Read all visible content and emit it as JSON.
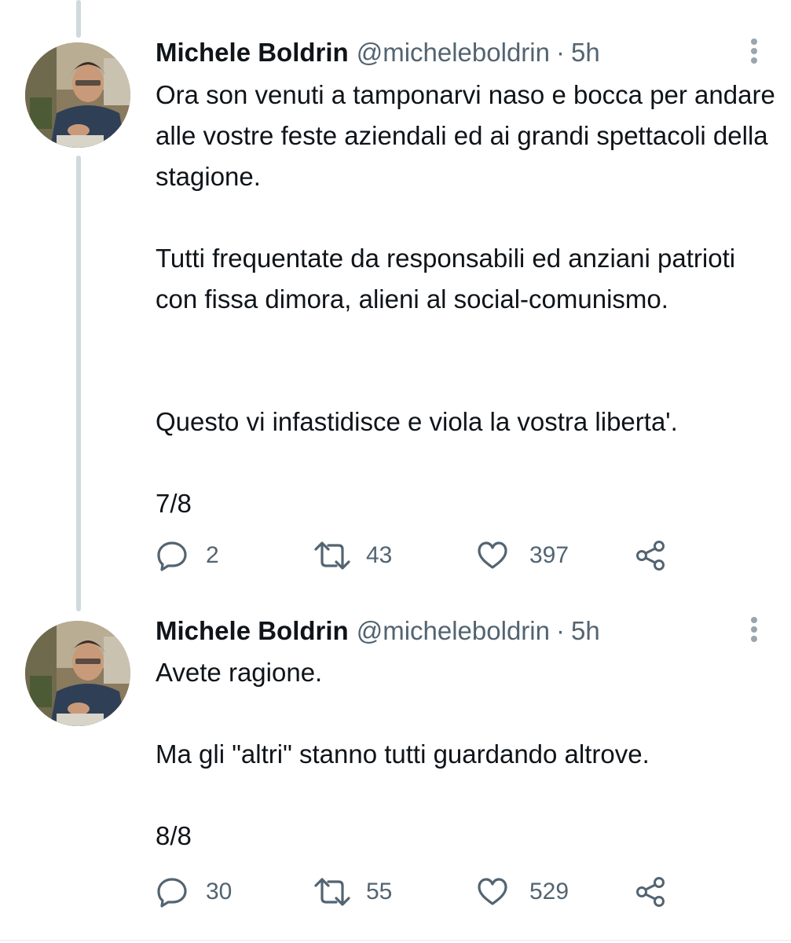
{
  "thread_color": "#cfd9de",
  "accent_text_color": "#536471",
  "tweets": [
    {
      "author_name": "Michele Boldrin",
      "author_handle": "@micheleboldrin",
      "separator": "·",
      "time": "5h",
      "avatar_icon": "profile-photo",
      "paragraphs": [
        "Ora son venuti a tamponarvi naso e bocca per andare alle vostre feste aziendali ed ai grandi spettacoli della stagione.",
        "Tutti frequentate da responsabili ed anziani patrioti con fissa dimora, alieni al social-comunismo.",
        "Questo vi infastidisce e viola la vostra liberta'.",
        "7/8"
      ],
      "replies": "2",
      "retweets": "43",
      "likes": "397",
      "icons": [
        "reply-icon",
        "retweet-icon",
        "like-icon",
        "share-icon",
        "more-options-icon"
      ]
    },
    {
      "author_name": "Michele Boldrin",
      "author_handle": "@micheleboldrin",
      "separator": "·",
      "time": "5h",
      "avatar_icon": "profile-photo",
      "paragraphs": [
        "Avete ragione.",
        "Ma gli \"altri\" stanno tutti guardando altrove.",
        "8/8"
      ],
      "replies": "30",
      "retweets": "55",
      "likes": "529",
      "icons": [
        "reply-icon",
        "retweet-icon",
        "like-icon",
        "share-icon",
        "more-options-icon"
      ]
    }
  ]
}
